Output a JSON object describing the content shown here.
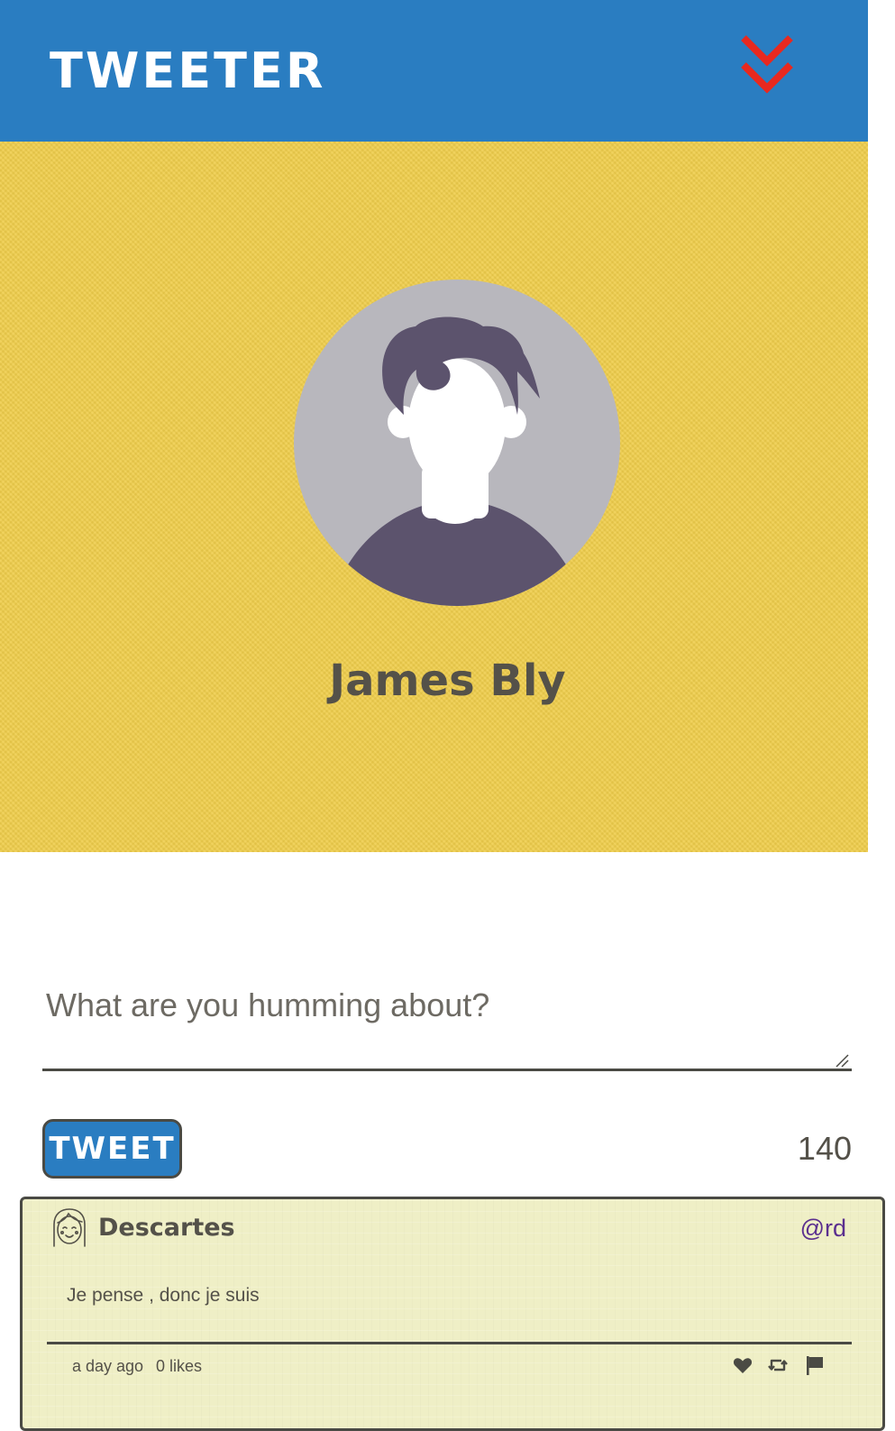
{
  "navbar": {
    "logo": "TWEETER",
    "toggle_icon": "double-chevron-down-icon",
    "bg_color": "#2a7dc1",
    "toggle_color": "#e8291f"
  },
  "profile": {
    "name": "James Bly",
    "avatar_icon": "user-silhouette-icon",
    "bg_color": "#efcd4b"
  },
  "compose": {
    "placeholder": "What are you humming about?",
    "value": "",
    "button_label": "TWEET",
    "char_count": "140"
  },
  "tweets": [
    {
      "author": "Descartes",
      "handle": "@rd",
      "content": "Je pense , donc je suis",
      "time": "a day ago",
      "likes": "0 likes",
      "avatar_icon": "girl-face-icon",
      "actions": [
        "heart-icon",
        "retweet-icon",
        "flag-icon"
      ]
    }
  ]
}
